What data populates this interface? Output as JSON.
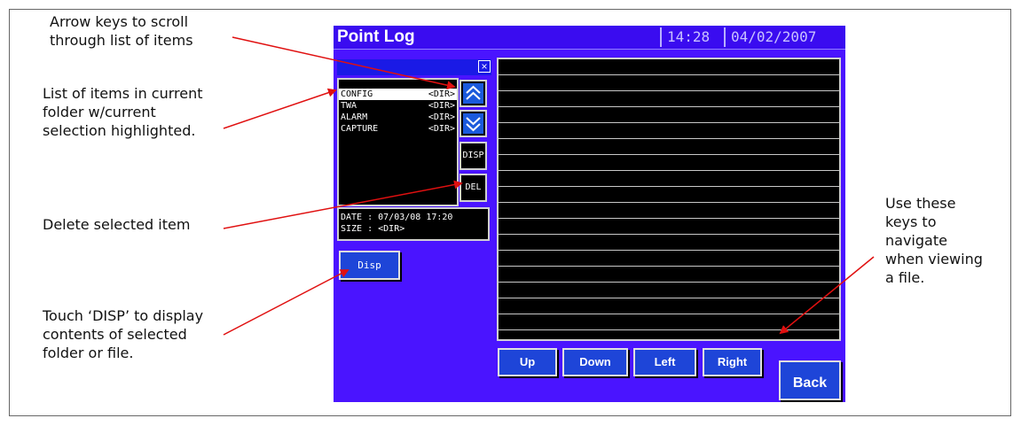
{
  "annotations": {
    "arrow_keys": "Arrow keys to scroll through list of items",
    "list_items": "List of items in current folder w/current selection highlighted.",
    "delete": "Delete selected item",
    "disp": "Touch ‘DISP’ to display contents of selected folder or file.",
    "nav_keys": "Use these keys to navigate when viewing a file."
  },
  "window": {
    "title": "Point Log",
    "time": "14:28",
    "date": "04/02/2007"
  },
  "browser": {
    "close_glyph": "×",
    "items": [
      {
        "name": "CONFIG",
        "type": "<DIR>",
        "selected": true
      },
      {
        "name": "TWA",
        "type": "<DIR>",
        "selected": false
      },
      {
        "name": "ALARM",
        "type": "<DIR>",
        "selected": false
      },
      {
        "name": "CAPTURE",
        "type": "<DIR>",
        "selected": false
      }
    ],
    "disp_label": "DISP",
    "del_label": "DEL",
    "info_date": "DATE : 07/03/08 17:20",
    "info_size": "SIZE : <DIR>"
  },
  "disp_button": "Disp",
  "nav": {
    "up": "Up",
    "down": "Down",
    "left": "Left",
    "right": "Right",
    "back": "Back"
  },
  "colors": {
    "panel": "#4a14ff",
    "button": "#1e45d8",
    "arrow": "#e01010"
  }
}
